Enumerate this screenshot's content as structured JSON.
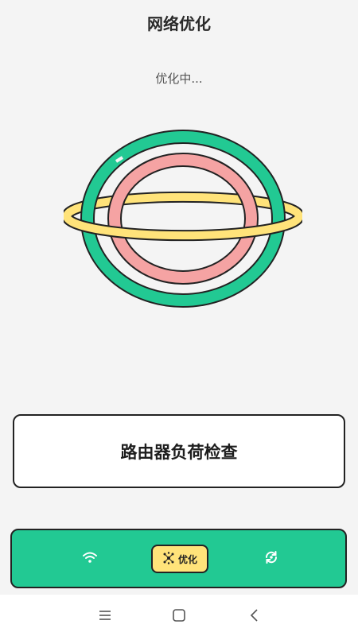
{
  "header": {
    "title": "网络优化"
  },
  "status": {
    "text": "优化中..."
  },
  "illustration": {
    "icon": "planet-icon",
    "colors": {
      "outer_ring": "#22c993",
      "inner_ring": "#f5a3a3",
      "orbit": "#ffe37a"
    }
  },
  "action": {
    "label": "路由器负荷检查"
  },
  "bottom_nav": {
    "background": "#22c993",
    "tabs": [
      {
        "icon": "wifi-icon",
        "label": ""
      },
      {
        "icon": "optimize-icon",
        "label": "优化",
        "active": true,
        "active_color": "#ffe37a"
      },
      {
        "icon": "refresh-icon",
        "label": ""
      }
    ]
  },
  "system_nav": {
    "buttons": [
      {
        "icon": "menu-icon"
      },
      {
        "icon": "home-icon"
      },
      {
        "icon": "back-icon"
      }
    ]
  }
}
